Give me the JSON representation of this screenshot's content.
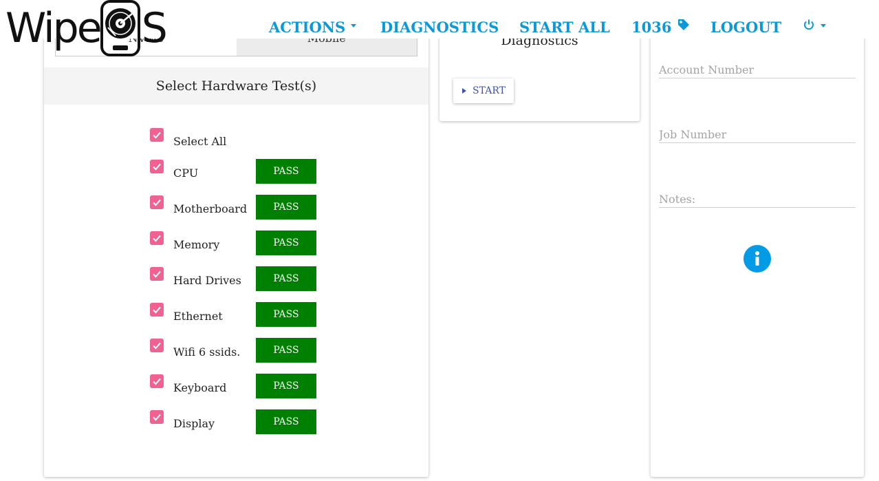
{
  "header": {
    "logo_left": "Wipe",
    "logo_right": "S",
    "nav": {
      "actions": "ACTIONS",
      "diagnostics": "DIAGNOSTICS",
      "start_all": "START ALL",
      "count": "1036",
      "logout": "LOGOUT"
    }
  },
  "tabs": [
    "NVMe",
    "Mobile"
  ],
  "hardware": {
    "title": "Select Hardware Test(s)",
    "select_all": "Select All",
    "tests": [
      {
        "label": "CPU",
        "status": "PASS"
      },
      {
        "label": "Motherboard",
        "status": "PASS"
      },
      {
        "label": "Memory",
        "status": "PASS"
      },
      {
        "label": "Hard Drives",
        "status": "PASS"
      },
      {
        "label": "Ethernet",
        "status": "PASS"
      },
      {
        "label": "Wifi 6 ssids.",
        "status": "PASS"
      },
      {
        "label": "Keyboard",
        "status": "PASS"
      },
      {
        "label": "Display",
        "status": "PASS"
      }
    ]
  },
  "diagnostics_card": {
    "title": "Diagnostics",
    "start_label": "START"
  },
  "form": {
    "account_placeholder": "Account Number",
    "job_placeholder": "Job Number",
    "notes_placeholder": "Notes:"
  },
  "colors": {
    "accent": "#0d99d6",
    "checkbox": "#f06292",
    "pass": "#008000",
    "info": "#039be5"
  }
}
